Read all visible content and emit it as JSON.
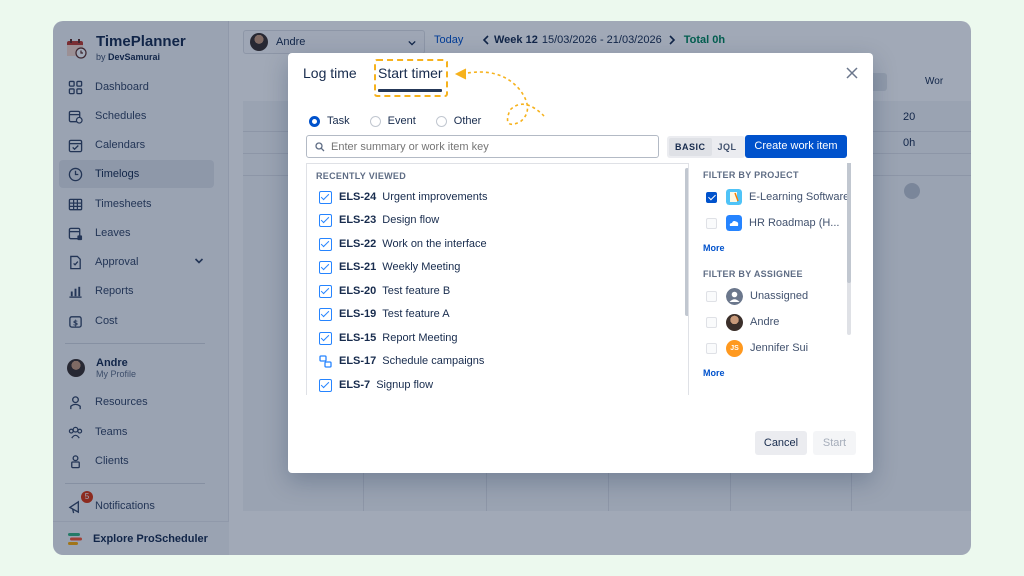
{
  "app": {
    "name": "TimePlanner",
    "by_prefix": "by",
    "by_company": "DevSamurai"
  },
  "sidebar": {
    "items": [
      {
        "label": "Dashboard",
        "icon": "dashboard-icon"
      },
      {
        "label": "Schedules",
        "icon": "schedules-icon"
      },
      {
        "label": "Calendars",
        "icon": "calendar-icon"
      },
      {
        "label": "Timelogs",
        "icon": "clock-icon",
        "active": true
      },
      {
        "label": "Timesheets",
        "icon": "table-icon"
      },
      {
        "label": "Leaves",
        "icon": "leave-calendar-icon"
      },
      {
        "label": "Approval",
        "icon": "approval-icon"
      },
      {
        "label": "Reports",
        "icon": "bar-chart-icon"
      },
      {
        "label": "Cost",
        "icon": "cost-icon"
      }
    ],
    "profile": {
      "name": "Andre",
      "sub": "My Profile"
    },
    "items2": [
      {
        "label": "Resources"
      },
      {
        "label": "Teams"
      },
      {
        "label": "Clients"
      }
    ],
    "notifications": {
      "label": "Notifications",
      "count": "5"
    },
    "explore": "Explore ProScheduler"
  },
  "header": {
    "user": "Andre",
    "today": "Today",
    "week_label": "Week 12",
    "week_range": "15/03/2026 - 21/03/2026",
    "total": "Total 0h",
    "right_btn": "Wor"
  },
  "grid": {
    "col_header_right": "20",
    "hours_right": "0h"
  },
  "modal": {
    "tab_log": "Log time",
    "tab_start": "Start timer",
    "radios": [
      {
        "label": "Task",
        "selected": true
      },
      {
        "label": "Event",
        "selected": false
      },
      {
        "label": "Other",
        "selected": false
      }
    ],
    "search_placeholder": "Enter summary or work item key",
    "seg_basic": "BASIC",
    "seg_jql": "JQL",
    "create_btn": "Create work item",
    "recent_head": "RECENTLY VIEWED",
    "items": [
      {
        "key": "ELS-24",
        "title": "Urgent improvements",
        "type": "task"
      },
      {
        "key": "ELS-23",
        "title": "Design flow",
        "type": "task"
      },
      {
        "key": "ELS-22",
        "title": "Work on the interface",
        "type": "task"
      },
      {
        "key": "ELS-21",
        "title": "Weekly Meeting",
        "type": "task"
      },
      {
        "key": "ELS-20",
        "title": "Test feature B",
        "type": "task"
      },
      {
        "key": "ELS-19",
        "title": "Test feature A",
        "type": "task"
      },
      {
        "key": "ELS-15",
        "title": "Report Meeting",
        "type": "task"
      },
      {
        "key": "ELS-17",
        "title": "Schedule campaigns",
        "type": "subtask"
      },
      {
        "key": "ELS-7",
        "title": "Signup flow",
        "type": "task"
      }
    ],
    "filter_project_head": "FILTER BY PROJECT",
    "projects": [
      {
        "label": "E-Learning Software",
        "checked": true
      },
      {
        "label": "HR Roadmap (H...",
        "checked": false
      }
    ],
    "more1": "More",
    "filter_assignee_head": "FILTER BY ASSIGNEE",
    "assignees": [
      {
        "label": "Unassigned",
        "initials": ""
      },
      {
        "label": "Andre",
        "initials": ""
      },
      {
        "label": "Jennifer Sui",
        "initials": "JS"
      }
    ],
    "more2": "More",
    "cancel": "Cancel",
    "start": "Start"
  },
  "colors": {
    "primary": "#0052cc",
    "highlight": "#f6b21d",
    "background": "#ecf9ee"
  }
}
